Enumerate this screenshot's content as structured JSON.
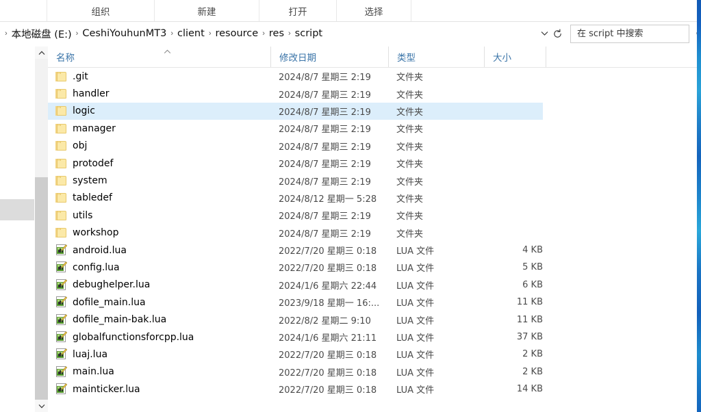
{
  "window": {
    "title": "script"
  },
  "command_bar": {
    "items": [
      {
        "label": "组织",
        "name": "organize"
      },
      {
        "label": "新建",
        "name": "new"
      },
      {
        "label": "打开",
        "name": "open"
      },
      {
        "label": "选择",
        "name": "select"
      }
    ]
  },
  "address_bar": {
    "leading_chevron": "›",
    "separator": "›",
    "crumbs": [
      "本地磁盘 (E:)",
      "CeshiYouhunMT3",
      "client",
      "resource",
      "res",
      "script"
    ],
    "dropdown_icon": "chevron-down-icon",
    "refresh_icon": "refresh-icon",
    "refresh_glyph": "↻"
  },
  "search": {
    "placeholder": "在 script 中搜索",
    "value": "",
    "icon": "search-icon"
  },
  "columns": {
    "name": "名称",
    "date_modified": "修改日期",
    "type": "类型",
    "size": "大小",
    "sort_indicator": "^",
    "sorted_by": "名称",
    "sort_direction": "ascending"
  },
  "scrollbar": {
    "up_glyph": "⌃",
    "down_glyph": "⌄"
  },
  "colors": {
    "selection": "#dceefb",
    "column_header_text": "#3a74a8",
    "folder": "#fbe9a8",
    "desktop_edge": "#1c79c6"
  },
  "rows": [
    {
      "icon": "folder-icon",
      "name": ".git",
      "date": "2024/8/7 星期三 2:19",
      "type": "文件夹",
      "size": "",
      "selected": false
    },
    {
      "icon": "folder-icon",
      "name": "handler",
      "date": "2024/8/7 星期三 2:19",
      "type": "文件夹",
      "size": "",
      "selected": false
    },
    {
      "icon": "folder-icon",
      "name": "logic",
      "date": "2024/8/7 星期三 2:19",
      "type": "文件夹",
      "size": "",
      "selected": true
    },
    {
      "icon": "folder-icon",
      "name": "manager",
      "date": "2024/8/7 星期三 2:19",
      "type": "文件夹",
      "size": "",
      "selected": false
    },
    {
      "icon": "folder-icon",
      "name": "obj",
      "date": "2024/8/7 星期三 2:19",
      "type": "文件夹",
      "size": "",
      "selected": false
    },
    {
      "icon": "folder-icon",
      "name": "protodef",
      "date": "2024/8/7 星期三 2:19",
      "type": "文件夹",
      "size": "",
      "selected": false
    },
    {
      "icon": "folder-icon",
      "name": "system",
      "date": "2024/8/7 星期三 2:19",
      "type": "文件夹",
      "size": "",
      "selected": false
    },
    {
      "icon": "folder-icon",
      "name": "tabledef",
      "date": "2024/8/12 星期一 5:28",
      "type": "文件夹",
      "size": "",
      "selected": false
    },
    {
      "icon": "folder-icon",
      "name": "utils",
      "date": "2024/8/7 星期三 2:19",
      "type": "文件夹",
      "size": "",
      "selected": false
    },
    {
      "icon": "folder-icon",
      "name": "workshop",
      "date": "2024/8/7 星期三 2:19",
      "type": "文件夹",
      "size": "",
      "selected": false
    },
    {
      "icon": "lua-file-icon",
      "name": "android.lua",
      "date": "2022/7/20 星期三 0:18",
      "type": "LUA 文件",
      "size": "4 KB",
      "selected": false
    },
    {
      "icon": "lua-file-icon",
      "name": "config.lua",
      "date": "2022/7/20 星期三 0:18",
      "type": "LUA 文件",
      "size": "5 KB",
      "selected": false
    },
    {
      "icon": "lua-file-icon",
      "name": "debughelper.lua",
      "date": "2024/1/6 星期六 22:44",
      "type": "LUA 文件",
      "size": "6 KB",
      "selected": false
    },
    {
      "icon": "lua-file-icon",
      "name": "dofile_main.lua",
      "date": "2023/9/18 星期一 16:...",
      "type": "LUA 文件",
      "size": "11 KB",
      "selected": false
    },
    {
      "icon": "lua-file-icon",
      "name": "dofile_main-bak.lua",
      "date": "2022/8/2 星期二 9:10",
      "type": "LUA 文件",
      "size": "11 KB",
      "selected": false
    },
    {
      "icon": "lua-file-icon",
      "name": "globalfunctionsforcpp.lua",
      "date": "2024/1/6 星期六 21:11",
      "type": "LUA 文件",
      "size": "37 KB",
      "selected": false
    },
    {
      "icon": "lua-file-icon",
      "name": "luaj.lua",
      "date": "2022/7/20 星期三 0:18",
      "type": "LUA 文件",
      "size": "2 KB",
      "selected": false
    },
    {
      "icon": "lua-file-icon",
      "name": "main.lua",
      "date": "2022/7/20 星期三 0:18",
      "type": "LUA 文件",
      "size": "2 KB",
      "selected": false
    },
    {
      "icon": "lua-file-icon",
      "name": "mainticker.lua",
      "date": "2022/7/20 星期三 0:18",
      "type": "LUA 文件",
      "size": "14 KB",
      "selected": false
    }
  ]
}
